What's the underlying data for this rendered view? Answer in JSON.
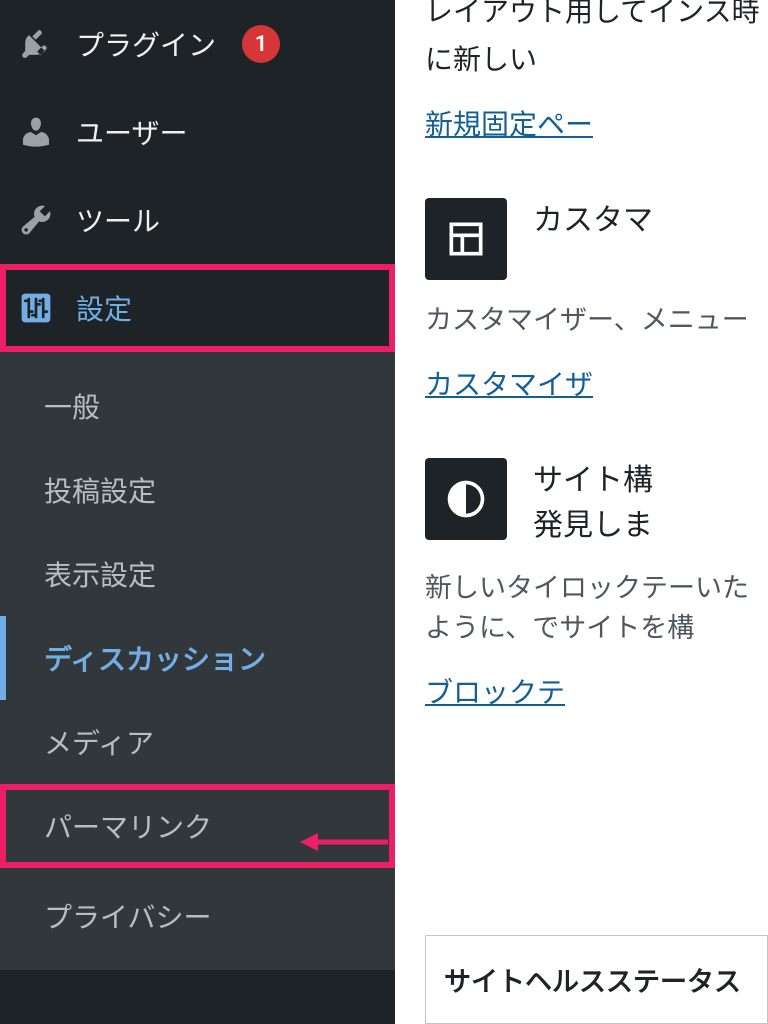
{
  "sidebar": {
    "plugins": {
      "label": "プラグイン",
      "badge": "1"
    },
    "users": {
      "label": "ユーザー"
    },
    "tools": {
      "label": "ツール"
    },
    "settings": {
      "label": "設定"
    },
    "submenu": {
      "general": "一般",
      "writing": "投稿設定",
      "reading": "表示設定",
      "discussion": "ディスカッション",
      "media": "メディア",
      "permalink": "パーマリンク",
      "privacy": "プライバシー"
    }
  },
  "content": {
    "intro_text": "レイアウト用してインス時に新しい",
    "intro_link": "新規固定ペー",
    "customize": {
      "title": "カスタマ",
      "desc": "カスタマイザー、メニュー",
      "link": "カスタマイザ"
    },
    "site": {
      "title_line1": "サイト構",
      "title_line2": "発見しま",
      "desc": "新しいタイロックテーいたように、でサイトを構",
      "link": "ブロックテ"
    },
    "status": {
      "title": "サイトヘルスステータス"
    }
  }
}
